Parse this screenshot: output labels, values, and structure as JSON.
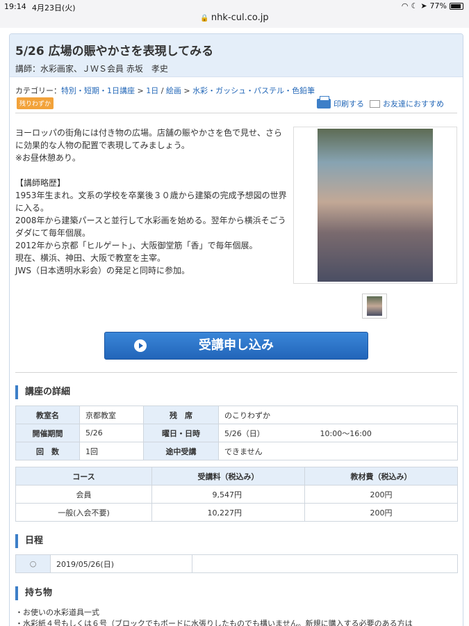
{
  "status": {
    "time": "19:14",
    "date": "4月23日(火)",
    "battery": "77%",
    "url": "nhk-cul.co.jp"
  },
  "course": {
    "title": "5/26 広場の賑やかさを表現してみる",
    "lecturer": "講師：水彩画家、ＪＷＳ会員 赤坂　孝史"
  },
  "category": {
    "label": "カテゴリー：",
    "links": [
      "特別・短期・1日講座",
      "1日",
      "絵画",
      "水彩・ガッシュ・パステル・色鉛筆"
    ],
    "sep1": " > ",
    "sep2": " / ",
    "sep3": " > "
  },
  "badge": "残りわずか",
  "actions": {
    "print": "印刷する",
    "share": "お友達におすすめ"
  },
  "description": {
    "intro1": "ヨーロッパの街角には付き物の広場。店舗の賑やかさを色で見せ、さらに効果的な人物の配置で表現してみましょう。",
    "intro2": "※お昼休憩あり。",
    "bio_heading": "【講師略歴】",
    "bio1": "1953年生まれ。文系の学校を卒業後３０歳から建築の完成予想図の世界に入る。",
    "bio2": "2008年から建築パースと並行して水彩画を始める。翌年から横浜そごうダダにて毎年個展。",
    "bio3": "2012年から京都「ヒルゲート」、大阪御堂筋「香」で毎年個展。",
    "bio4": "現在、横浜、神田、大阪で教室を主宰。",
    "bio5": "JWS（日本透明水彩会）の発足と同時に参加。"
  },
  "apply_button": "受講申し込み",
  "details": {
    "heading": "講座の詳細",
    "rows": [
      {
        "k1": "教室名",
        "v1": "京都教室",
        "k2": "残　席",
        "v2": "のこりわずか"
      },
      {
        "k1": "開催期間",
        "v1": "5/26",
        "k2": "曜日・日時",
        "v2": "5/26（日）",
        "v3": "10:00〜16:00"
      },
      {
        "k1": "回　数",
        "v1": "1回",
        "k2": "途中受講",
        "v2": "できません"
      }
    ]
  },
  "fees": {
    "headers": [
      "コース",
      "受講料（税込み）",
      "教材費（税込み）"
    ],
    "rows": [
      {
        "course": "会員",
        "fee": "9,547円",
        "material": "200円"
      },
      {
        "course": "一般(入会不要)",
        "fee": "10,227円",
        "material": "200円"
      }
    ]
  },
  "schedule": {
    "heading": "日程",
    "mark": "○",
    "date": "2019/05/26(日)"
  },
  "belongings": {
    "heading": "持ち物",
    "line1": "・お使いの水彩道具一式",
    "line2": "・水彩紙４号もしくは６号（ブロックでもボードに水張りしたものでも構いません。新規に購入する必要のある方は"
  },
  "colors": {
    "accent": "#2468b8",
    "header_bg": "#e4eef9",
    "badge": "#f2a23a",
    "button": "#2265b9"
  }
}
